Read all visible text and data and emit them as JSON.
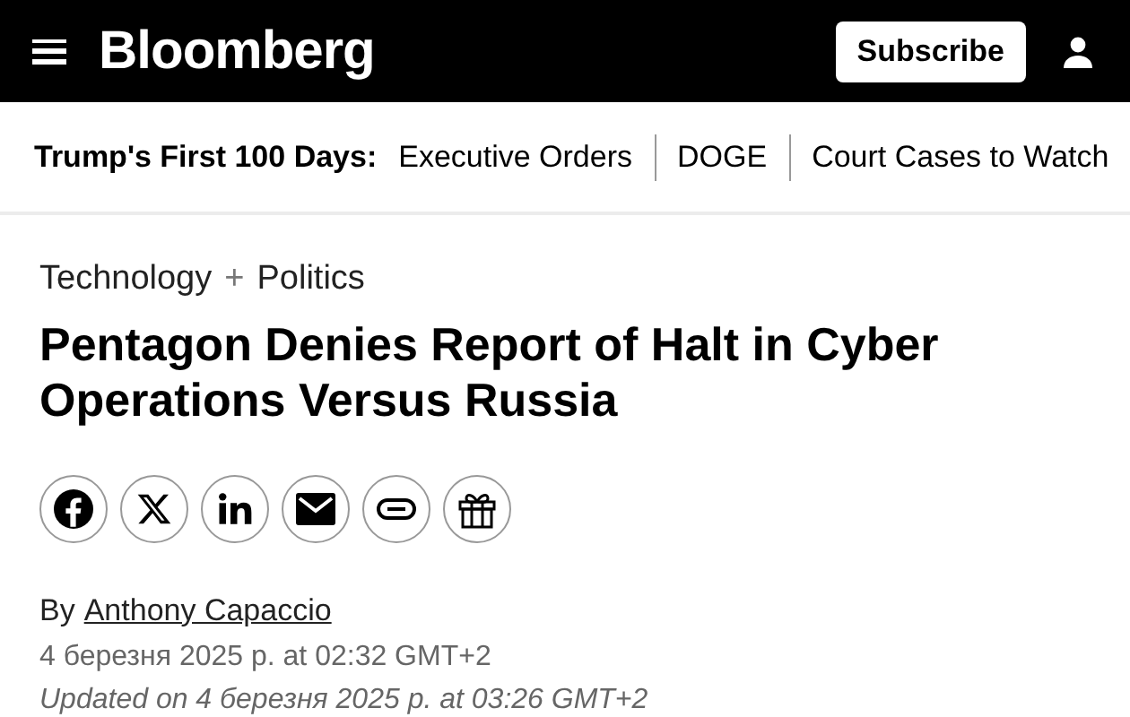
{
  "header": {
    "logo": "Bloomberg",
    "subscribe": "Subscribe"
  },
  "nav": {
    "label": "Trump's First 100 Days:",
    "items": [
      "Executive Orders",
      "DOGE",
      "Court Cases to Watch"
    ]
  },
  "categories": [
    "Technology",
    "+",
    "Politics"
  ],
  "headline": "Pentagon Denies Report of Halt in Cyber Operations Versus Russia",
  "share_buttons": [
    {
      "kind": "facebook"
    },
    {
      "kind": "x"
    },
    {
      "kind": "linkedin"
    },
    {
      "kind": "email"
    },
    {
      "kind": "link"
    },
    {
      "kind": "gift"
    }
  ],
  "byline": {
    "prefix": "By",
    "author": "Anthony Capaccio"
  },
  "published": "4 березня 2025 р. at 02:32 GMT+2",
  "updated": "Updated on 4 березня 2025 р. at 03:26 GMT+2"
}
